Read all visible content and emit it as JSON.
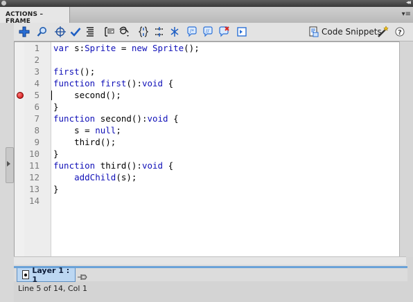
{
  "panel": {
    "tab_label": "ACTIONS – FRAME",
    "menu_icon": "panel-menu-icon"
  },
  "toolbar": {
    "icons": [
      "add-new-item-icon",
      "find-icon",
      "insert-target-path-icon",
      "check-syntax-icon",
      "auto-format-icon",
      "show-code-hint-icon",
      "debug-options-icon",
      "collapse-between-braces-icon",
      "collapse-selection-icon",
      "expand-all-icon",
      "apply-block-comment-icon",
      "apply-line-comment-icon",
      "remove-comment-icon",
      "show-hide-toolbox-icon",
      "code-snippets-icon",
      "wizard-icon",
      "help-icon"
    ],
    "code_snippets_label": "Code Snippets"
  },
  "editor": {
    "breakpoint_line": "5",
    "lines": [
      {
        "num": "1",
        "code": [
          {
            "t": "var",
            "k": 1
          },
          {
            "t": " s:"
          },
          {
            "t": "Sprite",
            "k": 1
          },
          {
            "t": " = "
          },
          {
            "t": "new",
            "k": 1
          },
          {
            "t": " "
          },
          {
            "t": "Sprite",
            "k": 1
          },
          {
            "t": "();"
          }
        ]
      },
      {
        "num": "2",
        "code": []
      },
      {
        "num": "3",
        "code": [
          {
            "t": "first",
            "k": 1
          },
          {
            "t": "();"
          }
        ]
      },
      {
        "num": "4",
        "code": [
          {
            "t": "function",
            "k": 1
          },
          {
            "t": " "
          },
          {
            "t": "first",
            "k": 1
          },
          {
            "t": "():"
          },
          {
            "t": "void",
            "k": 1
          },
          {
            "t": " {"
          }
        ]
      },
      {
        "num": "5",
        "code": [
          {
            "t": "    second();"
          }
        ]
      },
      {
        "num": "6",
        "code": [
          {
            "t": "}"
          }
        ]
      },
      {
        "num": "7",
        "code": [
          {
            "t": "function",
            "k": 1
          },
          {
            "t": " second():"
          },
          {
            "t": "void",
            "k": 1
          },
          {
            "t": " {"
          }
        ]
      },
      {
        "num": "8",
        "code": [
          {
            "t": "    s = "
          },
          {
            "t": "null",
            "k": 1
          },
          {
            "t": ";"
          }
        ]
      },
      {
        "num": "9",
        "code": [
          {
            "t": "    third();"
          }
        ]
      },
      {
        "num": "10",
        "code": [
          {
            "t": "}"
          }
        ]
      },
      {
        "num": "11",
        "code": [
          {
            "t": "function",
            "k": 1
          },
          {
            "t": " third():"
          },
          {
            "t": "void",
            "k": 1
          },
          {
            "t": " {"
          }
        ]
      },
      {
        "num": "12",
        "code": [
          {
            "t": "    "
          },
          {
            "t": "addChild",
            "k": 1
          },
          {
            "t": "(s);"
          }
        ]
      },
      {
        "num": "13",
        "code": [
          {
            "t": "}"
          }
        ]
      },
      {
        "num": "14",
        "code": []
      }
    ]
  },
  "layer_tab": {
    "label": "Layer 1 : 1",
    "icon": "frame-script-icon",
    "pin_icon": "pin-script-icon"
  },
  "status_bar": {
    "text": "Line 5 of 14, Col 1"
  },
  "colors": {
    "keyword": "#1010b8",
    "breakpoint": "#c40000",
    "selected_tab": "#bcd7f2"
  }
}
